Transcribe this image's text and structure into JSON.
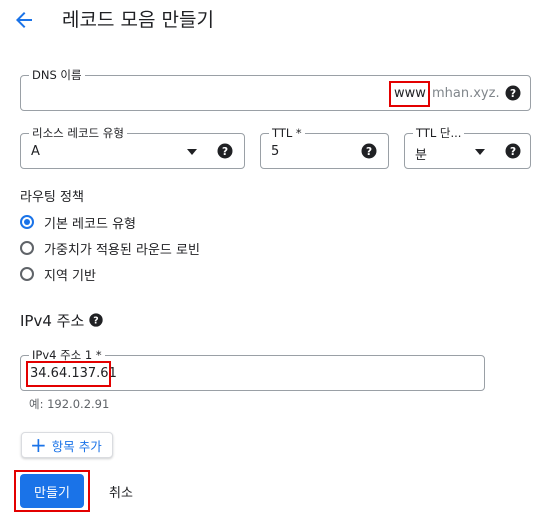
{
  "header": {
    "title": "레코드 모음 만들기",
    "back_icon": "arrow-left-icon",
    "accent_color": "#1a73e8"
  },
  "dns_name": {
    "label": "DNS 이름",
    "value": "www",
    "suffix": "mhan.xyz.",
    "help_icon": "help-circle-icon"
  },
  "record_type": {
    "label": "리소스 레코드 유형",
    "value": "A"
  },
  "ttl": {
    "label": "TTL *",
    "value": "5"
  },
  "ttl_unit": {
    "label": "TTL 단...",
    "value": "분"
  },
  "routing_policy": {
    "label": "라우팅 정책",
    "options": [
      "기본 레코드 유형",
      "가중치가 적용된 라운드 로빈",
      "지역 기반"
    ],
    "selected": "기본 레코드 유형"
  },
  "ipv4": {
    "section_title": "IPv4 주소",
    "field_label": "IPv4 주소 1 *",
    "value": "34.64.137.61",
    "hint": "예: 192.0.2.91"
  },
  "actions": {
    "add_item": "항목 추가",
    "create": "만들기",
    "cancel": "취소"
  },
  "highlight_color": "#e30000"
}
